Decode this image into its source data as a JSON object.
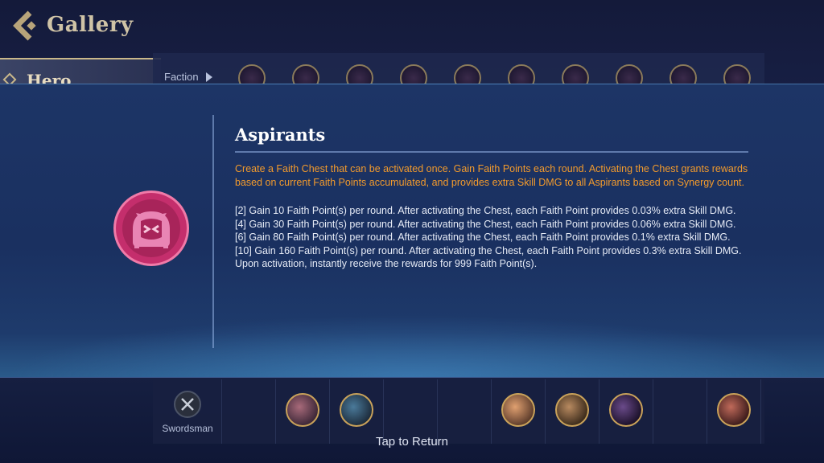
{
  "header": {
    "title": "Gallery"
  },
  "tabs": {
    "hero_label": "Hero"
  },
  "filter": {
    "faction_label": "Faction"
  },
  "faction_icons": [
    "faction-1",
    "faction-2",
    "faction-3",
    "faction-4",
    "faction-5",
    "faction-6",
    "faction-7",
    "faction-8",
    "faction-9",
    "faction-10"
  ],
  "role": {
    "label": "Swordsman"
  },
  "modal": {
    "title": "Aspirants",
    "description": "Create a Faith Chest that can be activated once. Gain Faith Points each round. Activating the Chest grants rewards based on current Faith Points accumulated, and provides extra Skill DMG to all Aspirants based on Synergy count.",
    "tiers": [
      "[2] Gain 10 Faith Point(s) per round. After activating the Chest, each Faith Point provides 0.03% extra Skill DMG.",
      "[4] Gain 30 Faith Point(s) per round. After activating the Chest, each Faith Point provides 0.06% extra Skill DMG.",
      "[6] Gain 80 Faith Point(s) per round. After activating the Chest, each Faith Point provides 0.1% extra Skill DMG.",
      "[10] Gain 160 Faith Point(s) per round. After activating the Chest, each Faith Point provides 0.3% extra Skill DMG. Upon activation, instantly receive the rewards for 999 Faith Point(s)."
    ]
  },
  "footer": {
    "tap_return": "Tap to Return"
  },
  "colors": {
    "accent_orange": "#f29a2c",
    "emblem_pink": "#d9357a",
    "gold": "#c9b78a"
  }
}
